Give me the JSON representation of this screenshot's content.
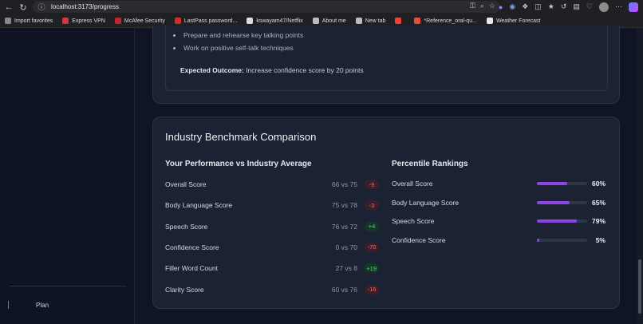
{
  "browser": {
    "url": "localhost:3173/progress",
    "bookmarks": [
      {
        "label": "Import favorites",
        "color": "#888888"
      },
      {
        "label": "Express VPN",
        "color": "#d8343a"
      },
      {
        "label": "McAfee Security",
        "color": "#c3242b"
      },
      {
        "label": "LastPass password...",
        "color": "#d32d27"
      },
      {
        "label": "kswayam47/Netflix",
        "color": "#dddddd"
      },
      {
        "label": "About me",
        "color": "#bbbbbb"
      },
      {
        "label": "New tab",
        "color": "#bbbbbb"
      },
      {
        "label": "",
        "color": "#ea4335"
      },
      {
        "label": "*Reference_oral-qu...",
        "color": "#e94e3c"
      },
      {
        "label": "Weather Forecast",
        "color": "#e8e8e8"
      }
    ]
  },
  "sidebar": {
    "plan_label": "Plan"
  },
  "plan_card": {
    "bullets": [
      "Prepare and rehearse key talking points",
      "Work on positive self-talk techniques"
    ],
    "outcome_label": "Expected Outcome:",
    "outcome_text": " Increase confidence score by 20 points"
  },
  "benchmark": {
    "title": "Industry Benchmark Comparison",
    "comparison_title": "Your Performance vs Industry Average",
    "comparison": [
      {
        "label": "Overall Score",
        "value": "66 vs 75",
        "delta": "-9",
        "positive": false
      },
      {
        "label": "Body Language Score",
        "value": "75 vs 78",
        "delta": "-3",
        "positive": false
      },
      {
        "label": "Speech Score",
        "value": "76 vs 72",
        "delta": "+4",
        "positive": true
      },
      {
        "label": "Confidence Score",
        "value": "0 vs 70",
        "delta": "-70",
        "positive": false
      },
      {
        "label": "Filler Word Count",
        "value": "27 vs 8",
        "delta": "+19",
        "positive": true
      },
      {
        "label": "Clarity Score",
        "value": "60 vs 76",
        "delta": "-16",
        "positive": false
      }
    ],
    "percentile_title": "Percentile Rankings",
    "percentiles": [
      {
        "label": "Overall Score",
        "value": 60,
        "display": "60%"
      },
      {
        "label": "Body Language Score",
        "value": 65,
        "display": "65%"
      },
      {
        "label": "Speech Score",
        "value": 79,
        "display": "79%"
      },
      {
        "label": "Confidence Score",
        "value": 5,
        "display": "5%"
      }
    ],
    "accent_color": "#8f45e6"
  }
}
